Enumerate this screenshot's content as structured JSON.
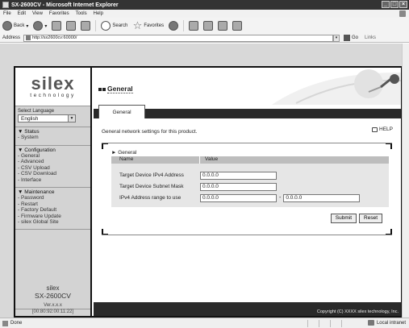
{
  "window": {
    "title": "SX-2600CV - Microsoft Internet Explorer"
  },
  "menu": [
    "File",
    "Edit",
    "View",
    "Favorites",
    "Tools",
    "Help"
  ],
  "toolbar": {
    "back": "Back",
    "search": "Search",
    "favorites": "Favorites"
  },
  "address": {
    "label": "Address",
    "url": "http://sx2600cv:60000/",
    "go": "Go",
    "links": "Links"
  },
  "sidebar": {
    "logo_main": "silex",
    "logo_sub": "technology",
    "language_label": "Select Language",
    "language_value": "English",
    "groups": [
      {
        "title": "▼ Status",
        "items": [
          "- System"
        ]
      },
      {
        "title": "▼ Configuration",
        "items": [
          "- General",
          "- Advanced",
          "- CSV Upload",
          "- CSV Download",
          "- Interface"
        ]
      },
      {
        "title": "▼ Maintenance",
        "items": [
          "- Password",
          "- Restart",
          "- Factory Default",
          "- Firmware Update",
          "- silex Global Site"
        ]
      }
    ],
    "brand": "silex",
    "model": "SX-2600CV",
    "version": "Ver.x.x.x",
    "mac": "[00:80:92:00:11:22]"
  },
  "main": {
    "title": "General",
    "tab": "General",
    "description": "General network settings for this product.",
    "help": "HELP",
    "section": "► General",
    "columns": {
      "name": "Name",
      "value": "Value"
    },
    "fields": [
      {
        "label": "Target Device IPv4 Address",
        "value": "0.0.0.0"
      },
      {
        "label": "Target Device Subnet Mask",
        "value": "0.0.0.0"
      },
      {
        "label": "IPv4 Address range to use",
        "value": "0.0.0.0",
        "value2": "0.0.0.0",
        "separator": "-"
      }
    ],
    "submit": "Submit",
    "reset": "Reset",
    "copyright": "Copyright (C) XXXX silex technology, Inc."
  },
  "status": {
    "text": "Done",
    "zone": "Local intranet"
  }
}
